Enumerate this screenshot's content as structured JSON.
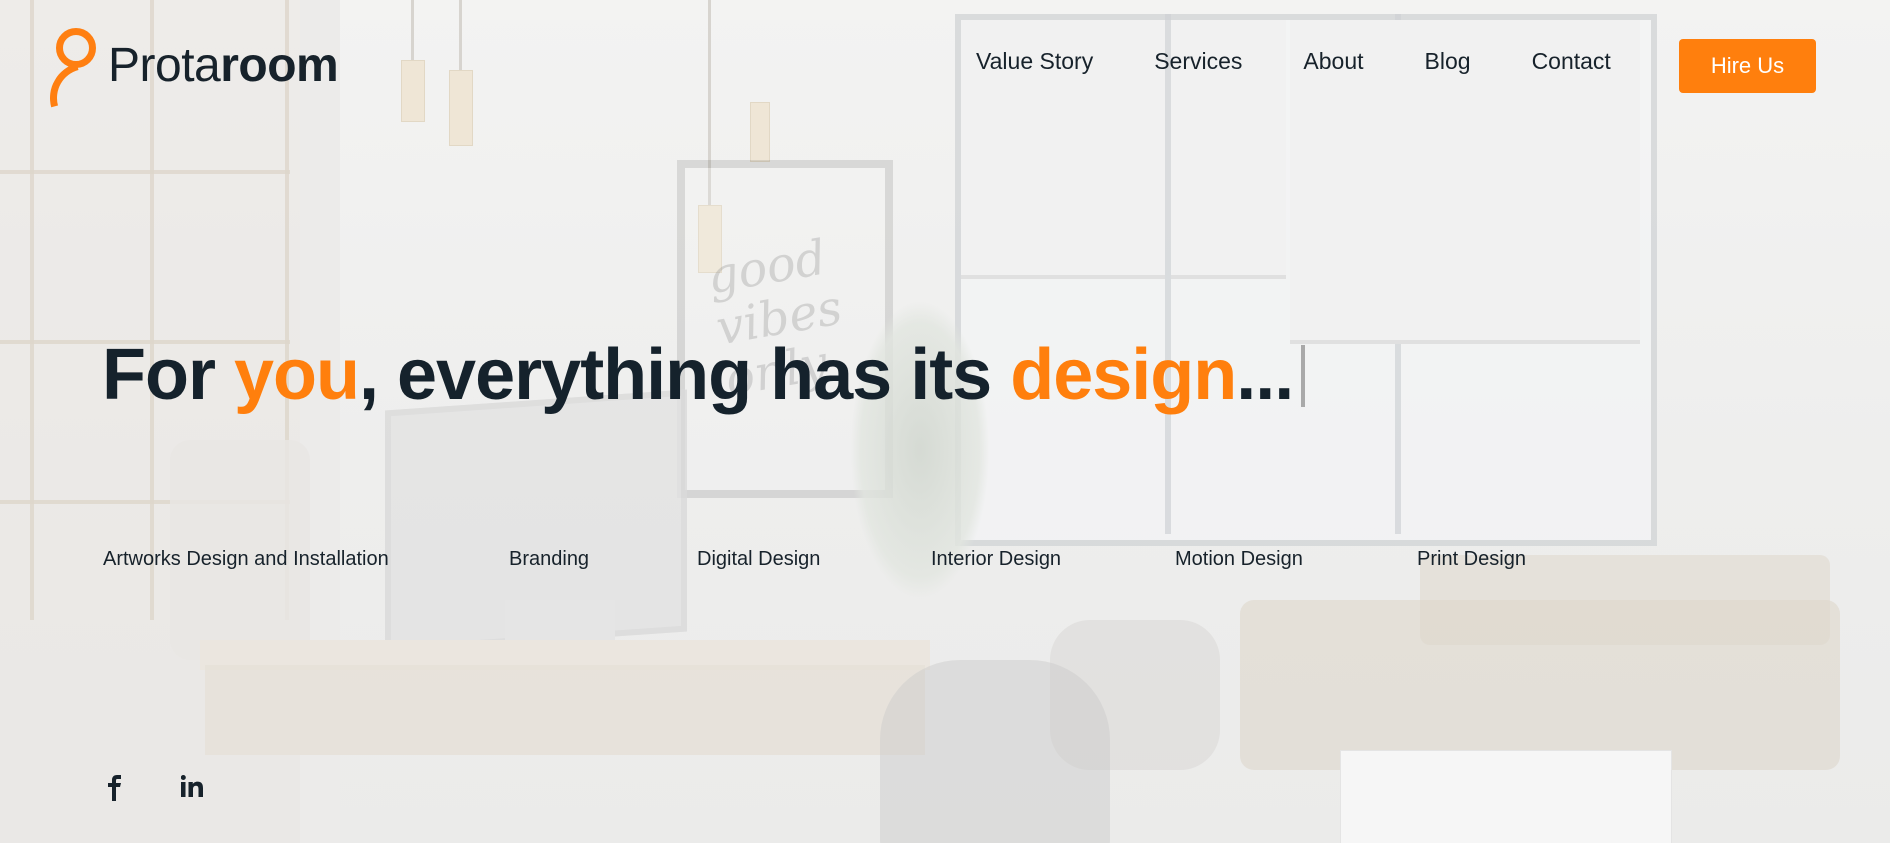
{
  "brand": {
    "name_light": "Prota",
    "name_bold": "room",
    "accent_color": "#ff7f0d",
    "text_color": "#17222b"
  },
  "nav": {
    "items": [
      "Value Story",
      "Services",
      "About",
      "Blog",
      "Contact"
    ],
    "cta_label": "Hire Us"
  },
  "hero": {
    "part1": "For ",
    "accent1": "you",
    "part2": ", everything has its ",
    "accent2": "design",
    "part3": "..."
  },
  "services": [
    "Artworks Design and Installation",
    "Branding",
    "Digital Design",
    "Interior Design",
    "Motion Design",
    "Print Design"
  ],
  "social": {
    "icons": [
      "facebook-icon",
      "linkedin-icon"
    ]
  }
}
